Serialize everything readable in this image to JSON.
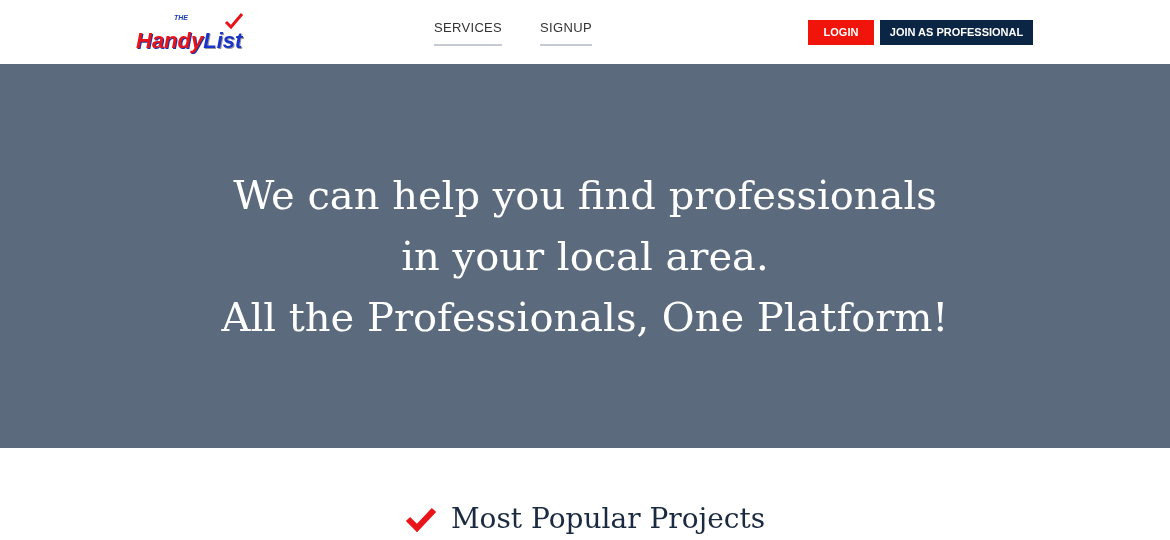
{
  "logo": {
    "small": "THE",
    "first": "Handy",
    "second": "List"
  },
  "nav": [
    {
      "label": "SERVICES"
    },
    {
      "label": "SIGNUP"
    }
  ],
  "buttons": [
    {
      "label": "LOGIN",
      "kind": "primary"
    },
    {
      "label": "JOIN AS PROFESSIONAL",
      "kind": "secondary"
    }
  ],
  "hero": {
    "lines": [
      "We can help you find professionals",
      "in your local area.",
      "All the Professionals, One Platform!"
    ]
  },
  "section": {
    "title": "Most Popular Projects"
  }
}
